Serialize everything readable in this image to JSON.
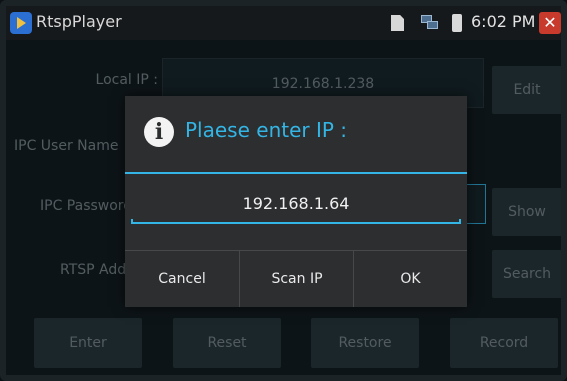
{
  "titlebar": {
    "app_title": "RtspPlayer",
    "time": "6:02 PM",
    "close_glyph": "✕",
    "icons": [
      "app-icon",
      "sd-card-icon",
      "network-icon",
      "battery-icon",
      "close-icon"
    ]
  },
  "form": {
    "local_ip_label": "Local IP :",
    "local_ip_value": "192.168.1.238",
    "ipc_user_label": "IPC User Name",
    "ipc_pass_label": "IPC Password",
    "rtsp_label": "RTSP Address"
  },
  "side_buttons": {
    "edit": "Edit",
    "show": "Show",
    "search": "Search"
  },
  "bottom_buttons": {
    "enter": "Enter",
    "reset": "Reset",
    "restore": "Restore",
    "record": "Record"
  },
  "dialog": {
    "title": "Plaese enter IP :",
    "info_glyph": "i",
    "ip_value": "192.168.1.64",
    "cancel": "Cancel",
    "scan_ip": "Scan IP",
    "ok": "OK"
  },
  "colors": {
    "accent": "#33b5e5",
    "close_red": "#c73a2c",
    "dialog_bg": "#2d2e30",
    "screen_bg": "#152024"
  }
}
